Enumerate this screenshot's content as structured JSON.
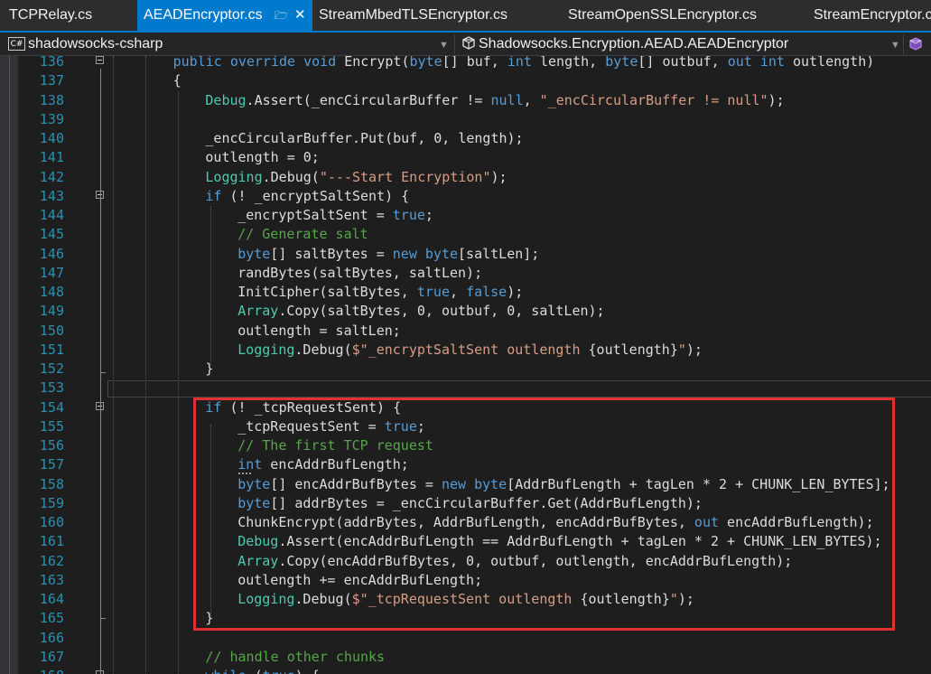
{
  "tabs": [
    {
      "label": "TCPRelay.cs",
      "active": false
    },
    {
      "label": "AEADEncryptor.cs",
      "active": true,
      "pin_icon": "pin-icon",
      "close_icon": "close-icon"
    },
    {
      "label": "StreamMbedTLSEncryptor.cs",
      "active": false
    },
    {
      "label": "StreamOpenSSLEncryptor.cs",
      "active": false
    },
    {
      "label": "StreamEncryptor.cs",
      "active": false
    }
  ],
  "navbar": {
    "project_badge": "C#",
    "project": "shadowsocks-csharp",
    "type_icon": "class-icon",
    "type": "Shadowsocks.Encryption.AEAD.AEADEncryptor",
    "member_icon": "method-icon"
  },
  "colors": {
    "accent": "#007acc",
    "editor_bg": "#1e1e1e",
    "keyword": "#569cd6",
    "type": "#4ec9b0",
    "string": "#d69d85",
    "comment": "#57a64a",
    "line_number": "#2b91af",
    "highlight_box": "#e03030"
  },
  "code_lines": [
    {
      "num": "136",
      "fold": true,
      "indent": 2,
      "tokens": [
        [
          "kw",
          "public"
        ],
        [
          "pl",
          " "
        ],
        [
          "kw",
          "override"
        ],
        [
          "pl",
          " "
        ],
        [
          "kw",
          "void"
        ],
        [
          "pl",
          " Encrypt("
        ],
        [
          "kw",
          "byte"
        ],
        [
          "pl",
          "[] buf, "
        ],
        [
          "kw",
          "int"
        ],
        [
          "pl",
          " length, "
        ],
        [
          "kw",
          "byte"
        ],
        [
          "pl",
          "[] outbuf, "
        ],
        [
          "kw",
          "out"
        ],
        [
          "pl",
          " "
        ],
        [
          "kw",
          "int"
        ],
        [
          "pl",
          " outlength)"
        ]
      ]
    },
    {
      "num": "137",
      "fold": false,
      "indent": 2,
      "tokens": [
        [
          "pl",
          "{"
        ]
      ]
    },
    {
      "num": "138",
      "fold": false,
      "indent": 3,
      "tokens": [
        [
          "ty",
          "Debug"
        ],
        [
          "pl",
          ".Assert(_encCircularBuffer != "
        ],
        [
          "kw",
          "null"
        ],
        [
          "pl",
          ", "
        ],
        [
          "st",
          "\"_encCircularBuffer != null\""
        ],
        [
          "pl",
          ");"
        ]
      ]
    },
    {
      "num": "139",
      "fold": false,
      "indent": 0,
      "tokens": []
    },
    {
      "num": "140",
      "fold": false,
      "indent": 3,
      "tokens": [
        [
          "pl",
          "_encCircularBuffer.Put(buf, 0, length);"
        ]
      ]
    },
    {
      "num": "141",
      "fold": false,
      "indent": 3,
      "tokens": [
        [
          "pl",
          "outlength = 0;"
        ]
      ]
    },
    {
      "num": "142",
      "fold": false,
      "indent": 3,
      "tokens": [
        [
          "ty",
          "Logging"
        ],
        [
          "pl",
          ".Debug("
        ],
        [
          "st",
          "\"---Start Encryption\""
        ],
        [
          "pl",
          ");"
        ]
      ]
    },
    {
      "num": "143",
      "fold": true,
      "indent": 3,
      "tokens": [
        [
          "kw",
          "if"
        ],
        [
          "pl",
          " (! _encryptSaltSent) {"
        ]
      ]
    },
    {
      "num": "144",
      "fold": false,
      "indent": 4,
      "tokens": [
        [
          "pl",
          "_encryptSaltSent = "
        ],
        [
          "kw",
          "true"
        ],
        [
          "pl",
          ";"
        ]
      ]
    },
    {
      "num": "145",
      "fold": false,
      "indent": 4,
      "tokens": [
        [
          "cm",
          "// Generate salt"
        ]
      ]
    },
    {
      "num": "146",
      "fold": false,
      "indent": 4,
      "tokens": [
        [
          "kw",
          "byte"
        ],
        [
          "pl",
          "[] saltBytes = "
        ],
        [
          "kw",
          "new"
        ],
        [
          "pl",
          " "
        ],
        [
          "kw",
          "byte"
        ],
        [
          "pl",
          "[saltLen];"
        ]
      ]
    },
    {
      "num": "147",
      "fold": false,
      "indent": 4,
      "tokens": [
        [
          "pl",
          "randBytes(saltBytes, saltLen);"
        ]
      ]
    },
    {
      "num": "148",
      "fold": false,
      "indent": 4,
      "tokens": [
        [
          "pl",
          "InitCipher(saltBytes, "
        ],
        [
          "kw",
          "true"
        ],
        [
          "pl",
          ", "
        ],
        [
          "kw",
          "false"
        ],
        [
          "pl",
          ");"
        ]
      ]
    },
    {
      "num": "149",
      "fold": false,
      "indent": 4,
      "tokens": [
        [
          "ty",
          "Array"
        ],
        [
          "pl",
          ".Copy(saltBytes, 0, outbuf, 0, saltLen);"
        ]
      ]
    },
    {
      "num": "150",
      "fold": false,
      "indent": 4,
      "tokens": [
        [
          "pl",
          "outlength = saltLen;"
        ]
      ]
    },
    {
      "num": "151",
      "fold": false,
      "indent": 4,
      "tokens": [
        [
          "ty",
          "Logging"
        ],
        [
          "pl",
          ".Debug("
        ],
        [
          "st",
          "$\"_encryptSaltSent outlength "
        ],
        [
          "pl",
          "{outlength}"
        ],
        [
          "st",
          "\""
        ],
        [
          "pl",
          ");"
        ]
      ]
    },
    {
      "num": "152",
      "fold": false,
      "indent": 3,
      "tokens": [
        [
          "pl",
          "}"
        ]
      ]
    },
    {
      "num": "153",
      "fold": false,
      "indent": 0,
      "tokens": []
    },
    {
      "num": "154",
      "fold": true,
      "indent": 3,
      "tokens": [
        [
          "kw",
          "if"
        ],
        [
          "pl",
          " (! _tcpRequestSent) {"
        ]
      ]
    },
    {
      "num": "155",
      "fold": false,
      "indent": 4,
      "tokens": [
        [
          "pl",
          "_tcpRequestSent = "
        ],
        [
          "kw",
          "true"
        ],
        [
          "pl",
          ";"
        ]
      ]
    },
    {
      "num": "156",
      "fold": false,
      "indent": 4,
      "tokens": [
        [
          "cm",
          "// The first TCP request"
        ]
      ]
    },
    {
      "num": "157",
      "fold": false,
      "indent": 4,
      "tokens": [
        [
          "kw",
          "int"
        ],
        [
          "pl",
          " encAddrBufLength;"
        ]
      ]
    },
    {
      "num": "158",
      "fold": false,
      "indent": 4,
      "tokens": [
        [
          "kw",
          "byte"
        ],
        [
          "pl",
          "[] encAddrBufBytes = "
        ],
        [
          "kw",
          "new"
        ],
        [
          "pl",
          " "
        ],
        [
          "kw",
          "byte"
        ],
        [
          "pl",
          "[AddrBufLength + tagLen * 2 + CHUNK_LEN_BYTES];"
        ]
      ]
    },
    {
      "num": "159",
      "fold": false,
      "indent": 4,
      "tokens": [
        [
          "kw",
          "byte"
        ],
        [
          "pl",
          "[] addrBytes = _encCircularBuffer.Get(AddrBufLength);"
        ]
      ]
    },
    {
      "num": "160",
      "fold": false,
      "indent": 4,
      "tokens": [
        [
          "pl",
          "ChunkEncrypt(addrBytes, AddrBufLength, encAddrBufBytes, "
        ],
        [
          "kw",
          "out"
        ],
        [
          "pl",
          " encAddrBufLength);"
        ]
      ]
    },
    {
      "num": "161",
      "fold": false,
      "indent": 4,
      "tokens": [
        [
          "ty",
          "Debug"
        ],
        [
          "pl",
          ".Assert(encAddrBufLength == AddrBufLength + tagLen * 2 + CHUNK_LEN_BYTES);"
        ]
      ]
    },
    {
      "num": "162",
      "fold": false,
      "indent": 4,
      "tokens": [
        [
          "ty",
          "Array"
        ],
        [
          "pl",
          ".Copy(encAddrBufBytes, 0, outbuf, outlength, encAddrBufLength);"
        ]
      ]
    },
    {
      "num": "163",
      "fold": false,
      "indent": 4,
      "tokens": [
        [
          "pl",
          "outlength += encAddrBufLength;"
        ]
      ]
    },
    {
      "num": "164",
      "fold": false,
      "indent": 4,
      "tokens": [
        [
          "ty",
          "Logging"
        ],
        [
          "pl",
          ".Debug("
        ],
        [
          "st",
          "$\"_tcpRequestSent outlength "
        ],
        [
          "pl",
          "{outlength}"
        ],
        [
          "st",
          "\""
        ],
        [
          "pl",
          ");"
        ]
      ]
    },
    {
      "num": "165",
      "fold": false,
      "indent": 3,
      "tokens": [
        [
          "pl",
          "}"
        ]
      ]
    },
    {
      "num": "166",
      "fold": false,
      "indent": 0,
      "tokens": []
    },
    {
      "num": "167",
      "fold": false,
      "indent": 3,
      "tokens": [
        [
          "cm",
          "// handle other chunks"
        ]
      ]
    },
    {
      "num": "168",
      "fold": true,
      "indent": 3,
      "tokens": [
        [
          "kw",
          "while"
        ],
        [
          "pl",
          " ("
        ],
        [
          "kw",
          "true"
        ],
        [
          "pl",
          ") {"
        ]
      ]
    }
  ]
}
